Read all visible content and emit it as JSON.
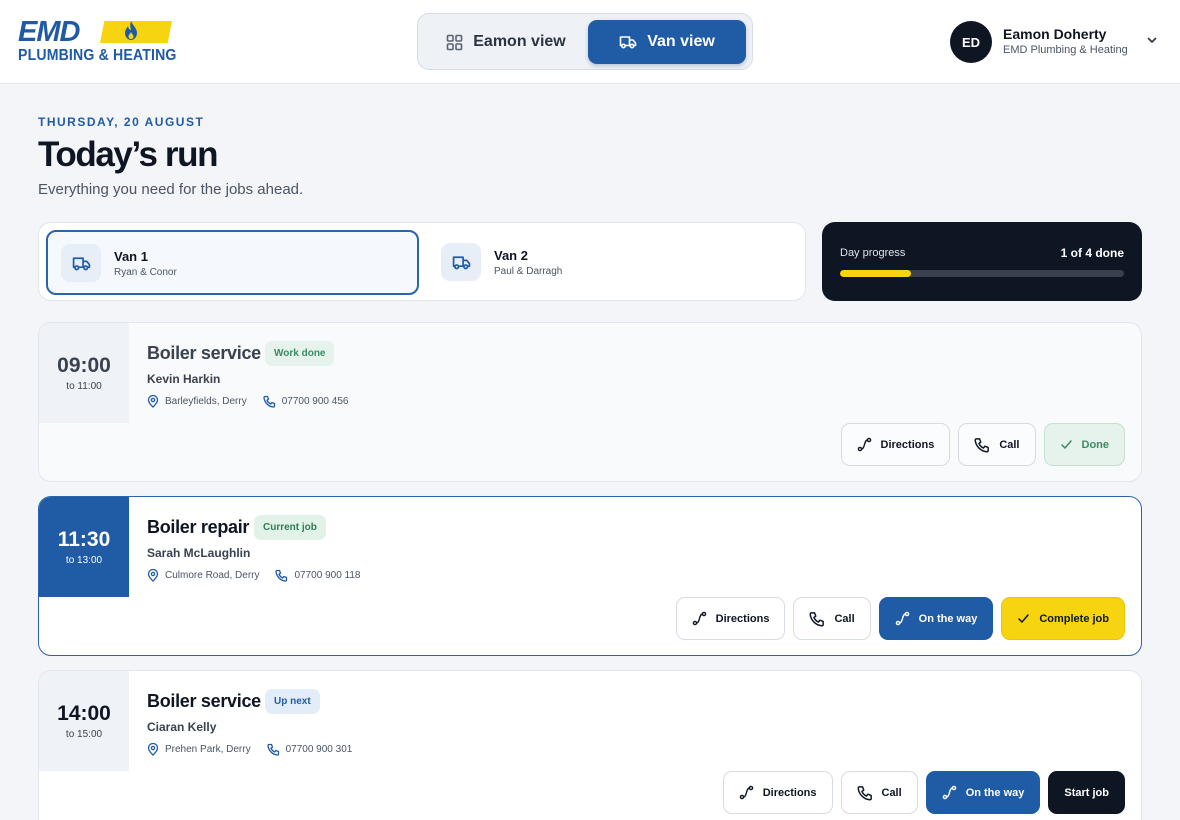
{
  "brand": {
    "logo_top": "EMD",
    "logo_bottom": "PLUMBING & HEATING",
    "colors": {
      "blue": "#205ba6",
      "yellow": "#f6d40f",
      "dark": "#0f1623"
    }
  },
  "view_switch": {
    "eamon_label": "Eamon view",
    "van_label": "Van view",
    "active": "van"
  },
  "user": {
    "initials": "ED",
    "name": "Eamon Doherty",
    "org": "EMD Plumbing & Heating"
  },
  "page": {
    "date": "THURSDAY, 20 AUGUST",
    "title": "Today’s run",
    "subtitle": "Everything you need for the jobs ahead."
  },
  "vans": [
    {
      "name": "Van 1",
      "crew": "Ryan & Conor",
      "selected": true
    },
    {
      "name": "Van 2",
      "crew": "Paul & Darragh",
      "selected": false
    }
  ],
  "progress": {
    "label": "Day progress",
    "count_text": "1 of 4 done",
    "fraction": 0.25
  },
  "jobs": [
    {
      "status": "done",
      "start": "09:00",
      "end": "to 11:00",
      "title": "Boiler service",
      "badge": "Work done",
      "customer": "Kevin Harkin",
      "address": "Barleyfields, Derry",
      "phone": "07700 900 456",
      "actions": {
        "directions": "Directions",
        "call": "Call",
        "primary": "Done"
      }
    },
    {
      "status": "current",
      "start": "11:30",
      "end": "to 13:00",
      "title": "Boiler repair",
      "badge": "Current job",
      "customer": "Sarah McLaughlin",
      "address": "Culmore Road, Derry",
      "phone": "07700 900 118",
      "actions": {
        "directions": "Directions",
        "call": "Call",
        "on_way": "On the way",
        "primary": "Complete job"
      }
    },
    {
      "status": "next",
      "start": "14:00",
      "end": "to 15:00",
      "title": "Boiler service",
      "badge": "Up next",
      "customer": "Ciaran Kelly",
      "address": "Prehen Park, Derry",
      "phone": "07700 900 301",
      "actions": {
        "directions": "Directions",
        "call": "Call",
        "on_way": "On the way",
        "primary": "Start job"
      }
    }
  ],
  "icons": [
    "grid-icon",
    "van-icon",
    "chevron-down-icon",
    "pin-icon",
    "phone-icon",
    "route-icon",
    "check-icon",
    "flame-icon"
  ]
}
